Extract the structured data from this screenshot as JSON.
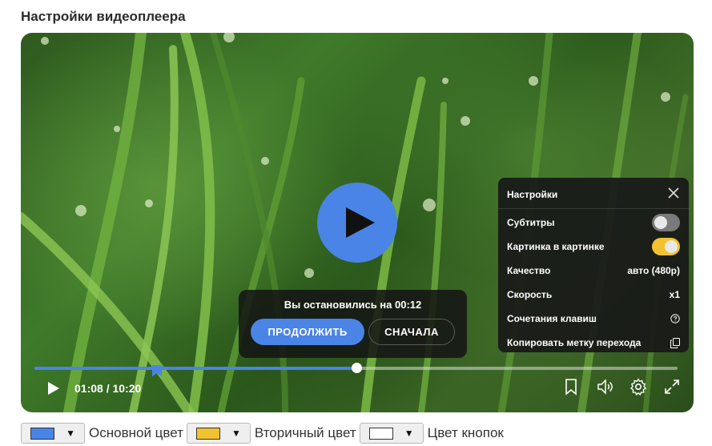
{
  "page": {
    "title": "Настройки видеоплеера"
  },
  "player": {
    "time_display": "01:08 / 10:20",
    "progress_fraction": 0.5,
    "bookmark_fraction": 0.19
  },
  "resume": {
    "text": "Вы остановились на 00:12",
    "continue_label": "ПРОДОЛЖИТЬ",
    "restart_label": "СНАЧАЛА"
  },
  "settings": {
    "title": "Настройки",
    "subtitles_label": "Субтитры",
    "subtitles_on": false,
    "pip_label": "Картинка в картинке",
    "pip_on": true,
    "quality_label": "Качество",
    "quality_value": "авто (480p)",
    "speed_label": "Скорость",
    "speed_value": "x1",
    "shortcuts_label": "Сочетания клавиш",
    "copy_label": "Копировать метку перехода"
  },
  "footer": {
    "primary_label": "Основной цвет",
    "primary_color": "#4a84e6",
    "secondary_label": "Вторичный цвет",
    "secondary_color": "#f2c230",
    "buttons_label": "Цвет кнопок",
    "buttons_color": "#ffffff",
    "dropdown_arrow": "▼"
  },
  "icons": {
    "play": "play-icon",
    "close": "close-icon",
    "help": "help-circle-icon",
    "copy": "copy-icon",
    "bookmark": "bookmark-icon",
    "volume": "volume-icon",
    "settings": "gear-icon",
    "fullscreen": "fullscreen-icon"
  }
}
